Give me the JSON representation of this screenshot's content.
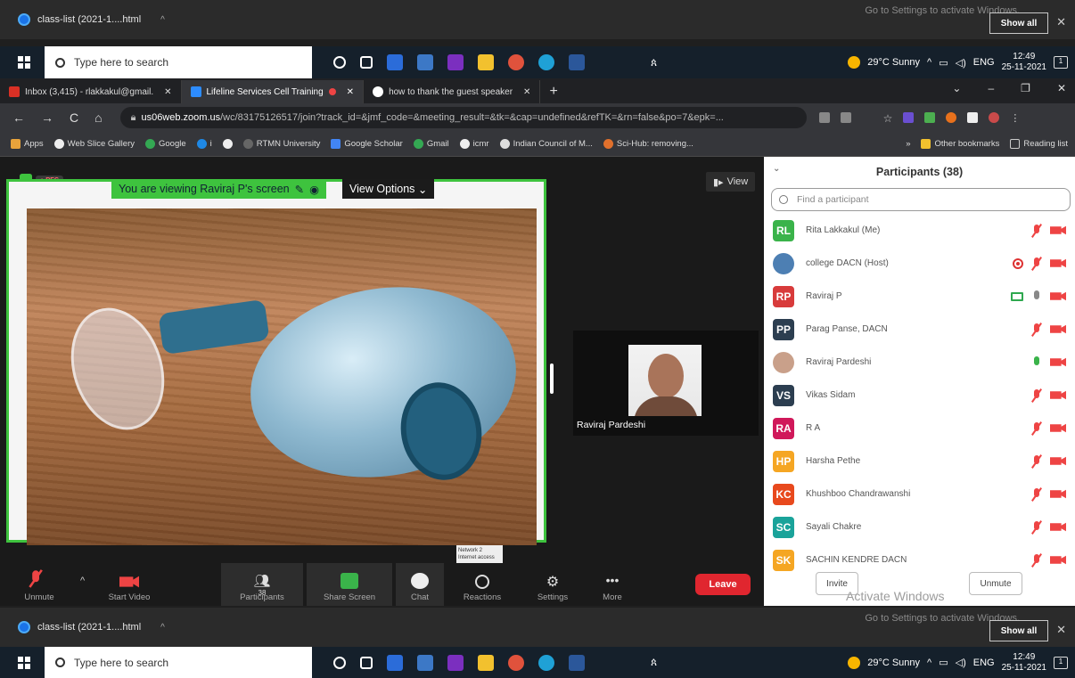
{
  "downloads_top": {
    "file": "class-list (2021-1....html",
    "show_all": "Show all",
    "activate": "Go to Settings to activate Windows."
  },
  "downloads_bottom": {
    "file": "class-list (2021-1....html",
    "show_all": "Show all",
    "activate": "Go to Settings to activate Windows."
  },
  "taskbar": {
    "search_placeholder": "Type here to search",
    "weather": "29°C  Sunny",
    "lang": "ENG",
    "time": "12:49",
    "date": "25-11-2021",
    "notif_count": "1"
  },
  "tabs": [
    {
      "label": "Inbox (3,415) - rlakkakul@gmail.",
      "color": "#d93025"
    },
    {
      "label": "Lifeline Services Cell Training",
      "color": "#2d8cff"
    },
    {
      "label": "how to thank the guest speaker",
      "color": "#4285f4"
    }
  ],
  "address": {
    "host": "us06web.zoom.us",
    "path": "/wc/83175126517/join?track_id=&jmf_code=&meeting_result=&tk=&cap=undefined&refTK=&rn=false&po=7&epk=..."
  },
  "bookmarks": [
    "Apps",
    "Web Slice Gallery",
    "Google",
    "i",
    "RTMN University",
    "Google Scholar",
    "Gmail",
    "icmr",
    "Indian Council of M...",
    "Sci-Hub: removing..."
  ],
  "bookmarks_right": {
    "other": "Other bookmarks",
    "reading": "Reading list",
    "more": "»"
  },
  "zoom": {
    "rec": "REC",
    "viewing": "You are viewing Raviraj P's screen",
    "view_options": "View Options",
    "view_button": "View",
    "network": "Network 2 Internet access",
    "thumb_name": "Raviraj Pardeshi",
    "toolbar": [
      {
        "label": "Unmute"
      },
      {
        "label": "Start Video"
      },
      {
        "label": "Participants",
        "badge": "38"
      },
      {
        "label": "Share Screen"
      },
      {
        "label": "Chat"
      },
      {
        "label": "Reactions"
      },
      {
        "label": "Settings"
      },
      {
        "label": "More"
      }
    ],
    "leave": "Leave"
  },
  "participants": {
    "title": "Participants (38)",
    "search_placeholder": "Find a participant",
    "list": [
      {
        "initials": "RL",
        "name": "Rita Lakkakul (Me)",
        "color": "#3ab34a",
        "mic": "off"
      },
      {
        "initials": "",
        "name": "college DACN (Host)",
        "color": "#4d7fb3",
        "mic": "off",
        "rec": true
      },
      {
        "initials": "RP",
        "name": "Raviraj P",
        "color": "#d83b3b",
        "mic": "on",
        "screen": true
      },
      {
        "initials": "PP",
        "name": "Parag Panse, DACN",
        "color": "#2c3e50",
        "mic": "off"
      },
      {
        "initials": "",
        "name": "Raviraj Pardeshi",
        "color": "#c9a08a",
        "mic": "green"
      },
      {
        "initials": "VS",
        "name": "Vikas Sidam",
        "color": "#2c3e50",
        "mic": "off"
      },
      {
        "initials": "RA",
        "name": "R A",
        "color": "#d0185a",
        "mic": "off"
      },
      {
        "initials": "HP",
        "name": "Harsha Pethe",
        "color": "#f5a623",
        "mic": "off"
      },
      {
        "initials": "KC",
        "name": "Khushboo Chandrawanshi",
        "color": "#e8491d",
        "mic": "off"
      },
      {
        "initials": "SC",
        "name": "Sayali Chakre",
        "color": "#1aa39a",
        "mic": "off"
      },
      {
        "initials": "SK",
        "name": "SACHIN KENDRE DACN",
        "color": "#f5a623",
        "mic": "off"
      }
    ],
    "invite": "Invite",
    "unmute": "Unmute",
    "watermark": "Activate Windows"
  }
}
